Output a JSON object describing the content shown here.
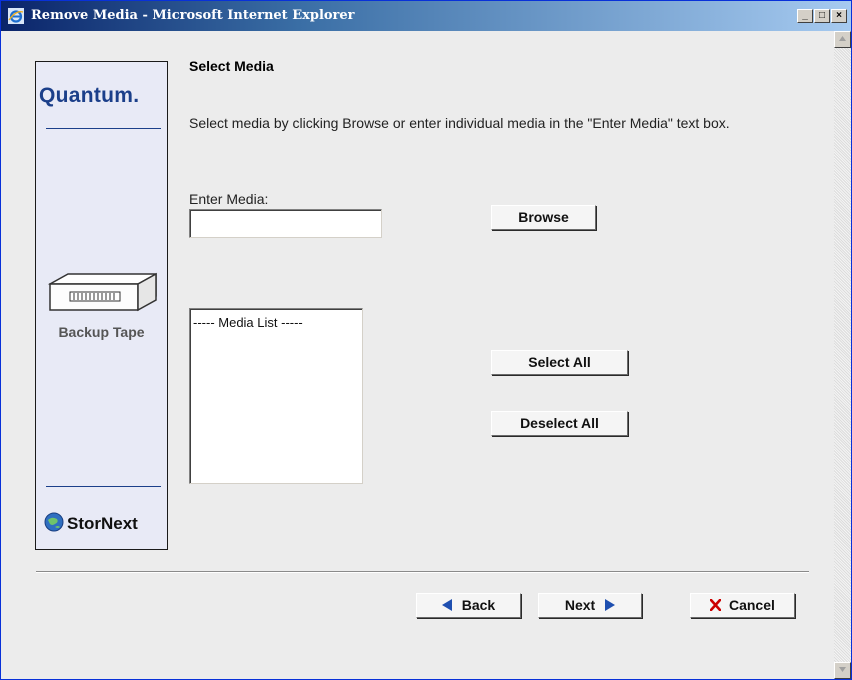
{
  "window": {
    "title": "Remove Media - Microsoft Internet Explorer",
    "minimize_glyph": "_",
    "maximize_glyph": "□",
    "close_glyph": "×"
  },
  "sidebar": {
    "brand": "Quantum.",
    "tape_label": "Backup Tape",
    "product": "StorNext"
  },
  "main": {
    "heading": "Select Media",
    "description": "Select media by clicking Browse or enter individual media in the \"Enter Media\" text box.",
    "enter_media_label": "Enter Media:",
    "enter_media_value": "",
    "browse_label": "Browse",
    "media_list_header": "----- Media List -----",
    "select_all_label": "Select All",
    "deselect_all_label": "Deselect All"
  },
  "footer": {
    "back_label": "Back",
    "next_label": "Next",
    "cancel_label": "Cancel"
  },
  "colors": {
    "title_bar_start": "#0a246a",
    "brand_blue": "#1b3f8a",
    "cancel_x": "#cc0000",
    "nav_arrow": "#1e4fb0"
  }
}
